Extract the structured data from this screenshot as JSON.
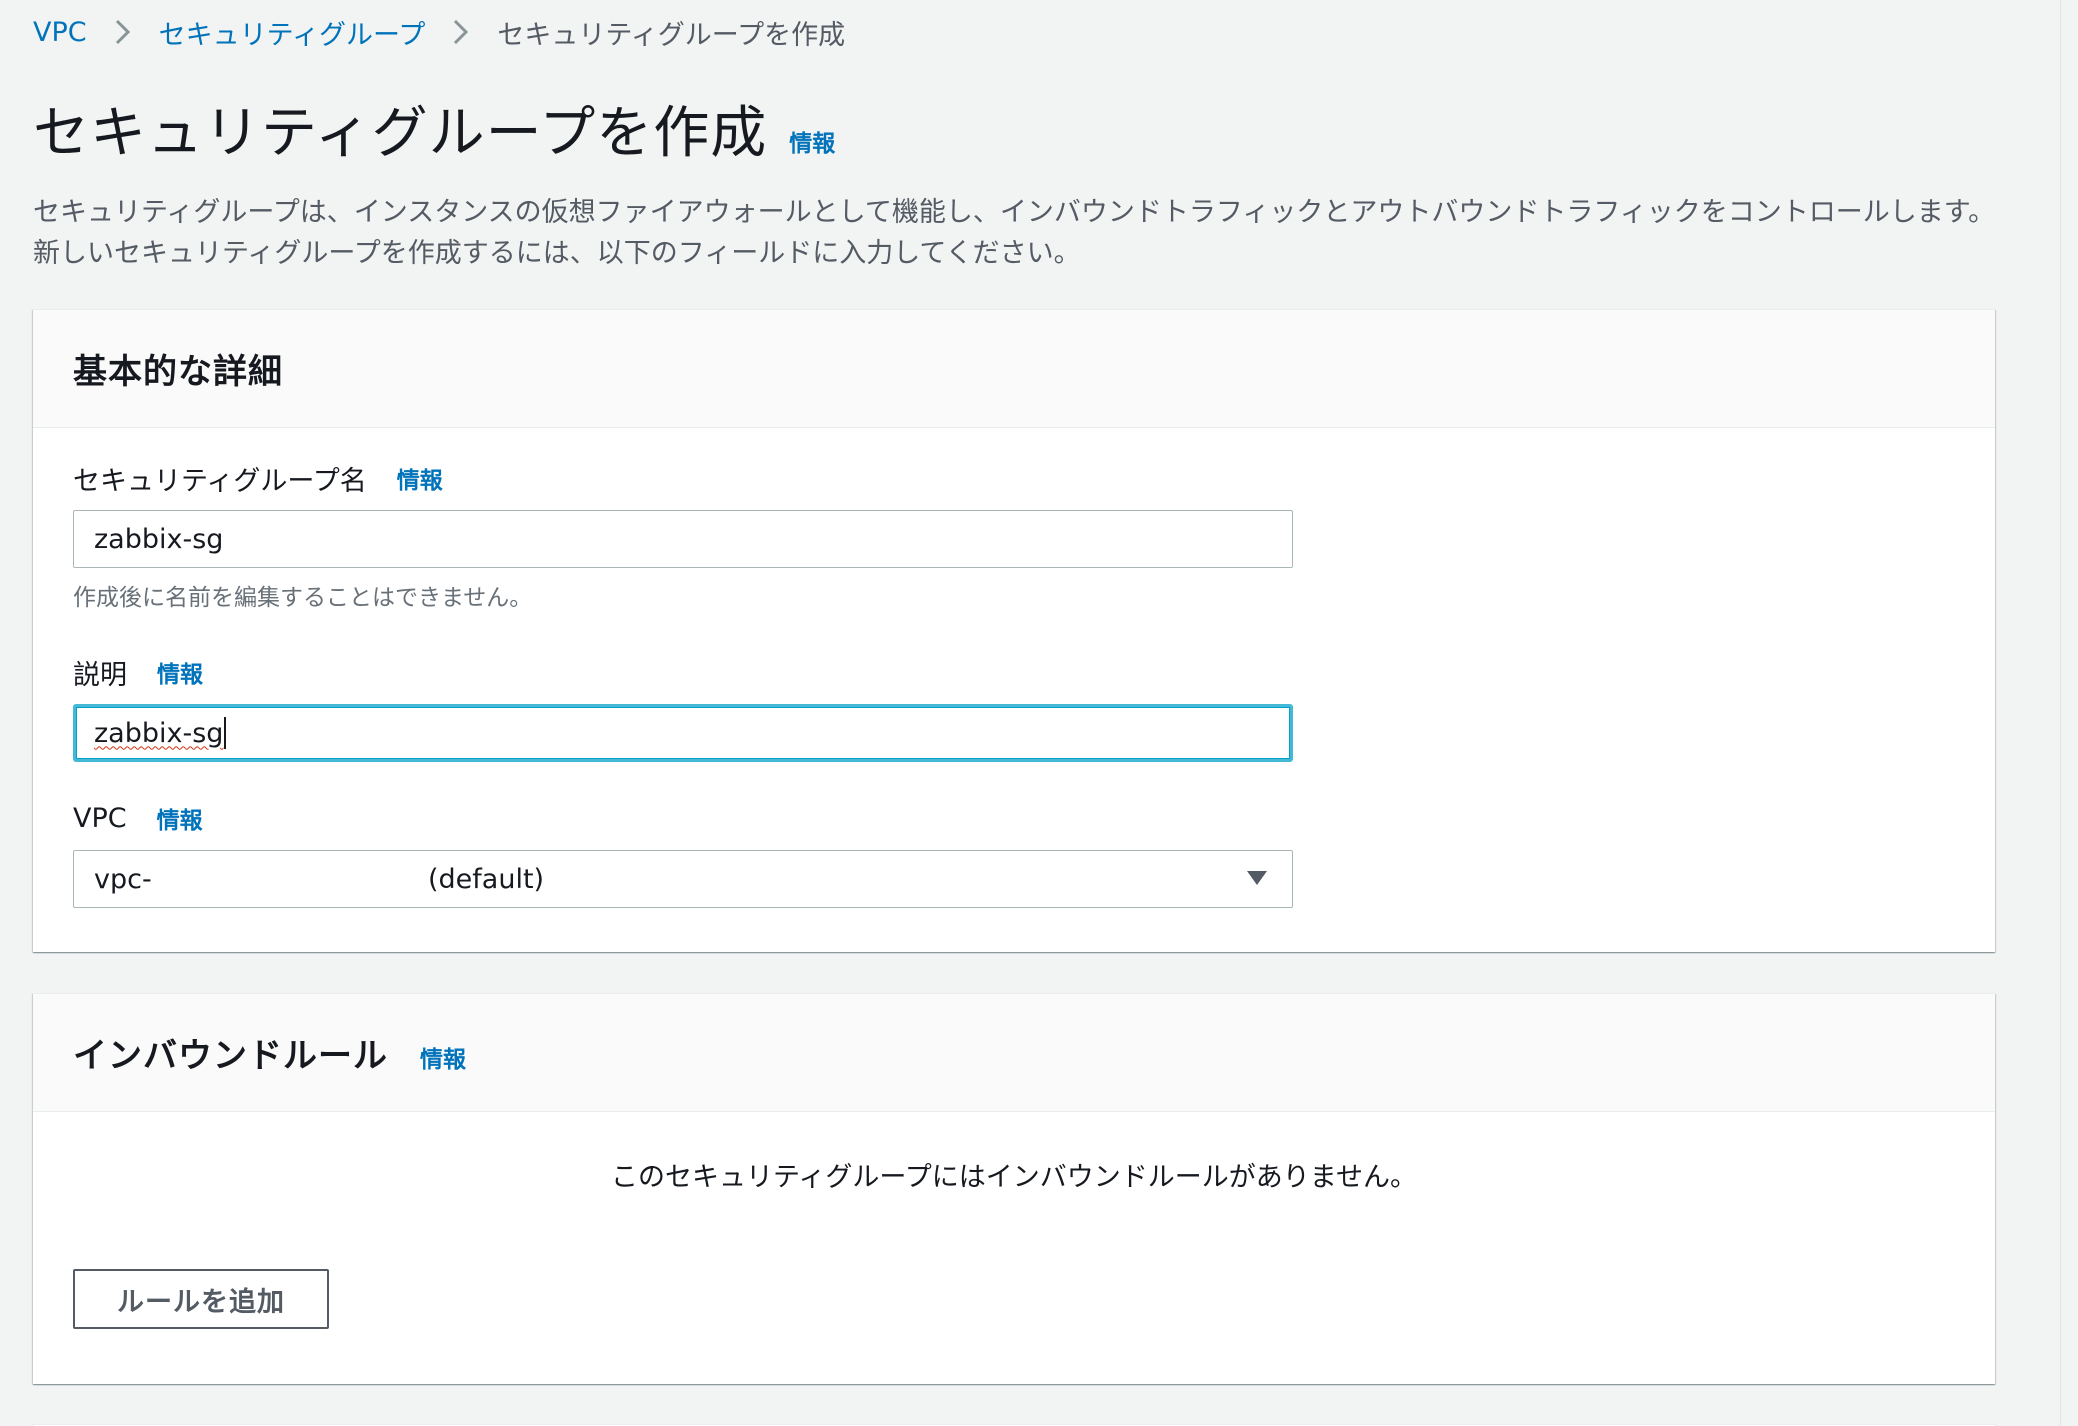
{
  "breadcrumb": {
    "items": [
      {
        "label": "VPC"
      },
      {
        "label": "セキュリティグループ"
      }
    ],
    "current": "セキュリティグループを作成"
  },
  "header": {
    "title": "セキュリティグループを作成",
    "info": "情報",
    "description": "セキュリティグループは、インスタンスの仮想ファイアウォールとして機能し、インバウンドトラフィックとアウトバウンドトラフィックをコントロールします。新しいセキュリティグループを作成するには、以下のフィールドに入力してください。"
  },
  "details_panel": {
    "title": "基本的な詳細",
    "name_field": {
      "label": "セキュリティグループ名",
      "info": "情報",
      "value": "zabbix-sg",
      "constraint": "作成後に名前を編集することはできません。"
    },
    "description_field": {
      "label": "説明",
      "info": "情報",
      "value": "zabbix-sg"
    },
    "vpc_field": {
      "label": "VPC",
      "info": "情報",
      "selected_id": "vpc-",
      "selected_suffix": "(default)"
    }
  },
  "inbound_panel": {
    "title": "インバウンドルール",
    "info": "情報",
    "empty_message": "このセキュリティグループにはインバウンドルールがありません。",
    "add_rule_label": "ルールを追加"
  },
  "colors": {
    "link": "#0073bb",
    "focus": "#44b9d6",
    "background": "#f2f3f3"
  }
}
